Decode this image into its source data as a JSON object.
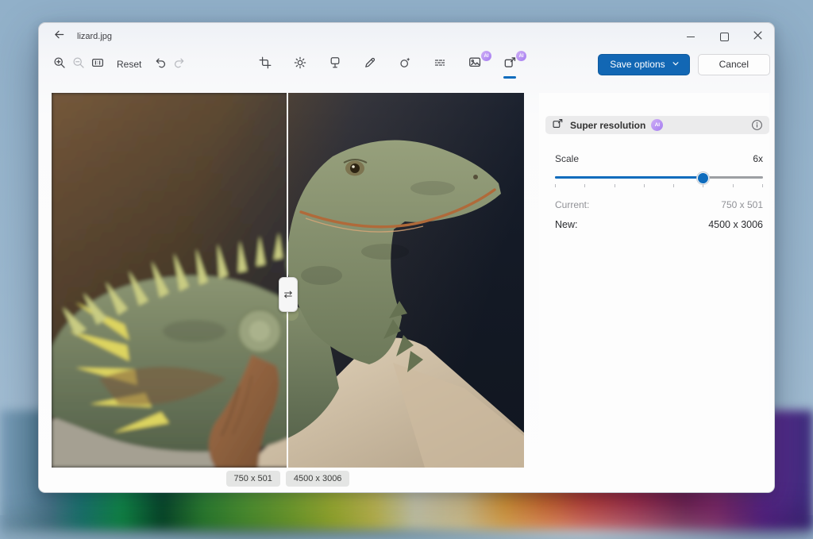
{
  "labels": {
    "ai": "AI"
  },
  "window": {
    "title": "lizard.jpg",
    "controls": [
      "back",
      "minimize",
      "maximize",
      "close"
    ]
  },
  "toolbar": {
    "reset": "Reset",
    "save_options": "Save options",
    "cancel": "Cancel",
    "left_tools": [
      "zoom-in",
      "zoom-out",
      "actual-size",
      "reset",
      "undo",
      "redo"
    ],
    "disabled_tools": [
      "zoom-out",
      "redo"
    ],
    "center_tools": [
      "crop",
      "adjust",
      "filter",
      "markup",
      "retouch",
      "blur-background",
      "generative-erase",
      "super-resolution"
    ],
    "ai_tools": [
      "generative-erase",
      "super-resolution"
    ],
    "active_tool": "super-resolution"
  },
  "panel": {
    "title": "Super resolution",
    "scale_label": "Scale",
    "scale_value": "6x",
    "slider": {
      "min": 1,
      "max": 8,
      "value": 6,
      "ticks": 8
    },
    "current_label": "Current:",
    "current_value": "750 x 501",
    "new_label": "New:",
    "new_value": "4500 x 3006"
  },
  "viewer": {
    "subject": "iguana-photo",
    "before_size": "750 x 501",
    "after_size": "4500 x 3006",
    "split_handle": "compare-slider"
  },
  "colors": {
    "accent": "#0f6cbd",
    "ai_badge": "#b48cf2",
    "panel_header_bg": "#ebebec"
  }
}
